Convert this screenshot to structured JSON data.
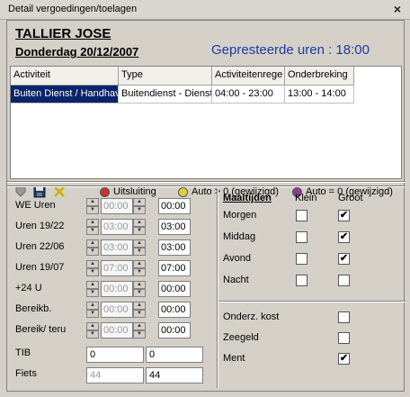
{
  "window": {
    "title": "Detail vergoedingen/toelagen",
    "close_glyph": "×"
  },
  "header": {
    "name": "TALLIER JOSE",
    "date": "Donderdag 20/12/2007",
    "hours_text": "Gepresteerde uren : 18:00"
  },
  "grid": {
    "columns": [
      "Activiteit",
      "Type",
      "Activiteitenrege",
      "Onderbreking"
    ],
    "rows": [
      [
        "Buiten Dienst / Handhav",
        "Buitendienst - Dienst",
        "04:00 - 23:00",
        "13:00 - 14:00"
      ]
    ]
  },
  "toolbar": {
    "icons": [
      "shield-icon",
      "save-icon",
      "cancel-icon"
    ],
    "legend": [
      {
        "label": "Uitsluiting",
        "color": "#c83232"
      },
      {
        "label": "Auto > 0 (gewijzigd)",
        "color": "#e0d23a"
      },
      {
        "label": "Auto = 0 (gewijzigd)",
        "color": "#8a3c96"
      }
    ]
  },
  "hours_rows": [
    {
      "label": "WE Uren",
      "from": "00:00",
      "to": "00:00",
      "from_dim": true,
      "to_dim": false
    },
    {
      "label": "Uren 19/22",
      "from": "03:00",
      "to": "03:00",
      "from_dim": true,
      "to_dim": false
    },
    {
      "label": "Uren 22/06",
      "from": "03:00",
      "to": "03:00",
      "from_dim": true,
      "to_dim": false
    },
    {
      "label": "Uren 19/07",
      "from": "07:00",
      "to": "07:00",
      "from_dim": true,
      "to_dim": false
    },
    {
      "label": "+24 U",
      "from": "00:00",
      "to": "00:00",
      "from_dim": true,
      "to_dim": false
    },
    {
      "label": "Bereikb.",
      "from": "00:00",
      "to": "00:00",
      "from_dim": true,
      "to_dim": false
    },
    {
      "label": "Bereik/ teru",
      "from": "00:00",
      "to": "00:00",
      "from_dim": true,
      "to_dim": false
    }
  ],
  "tib": {
    "label": "TIB",
    "left": "0",
    "right": "0"
  },
  "fiets": {
    "label": "Fiets",
    "left": "44",
    "right": "44"
  },
  "meals": {
    "title": "Maaltijden",
    "col_small": "Klein",
    "col_large": "Groot",
    "rows": [
      {
        "label": "Morgen",
        "klein": false,
        "groot": true
      },
      {
        "label": "Middag",
        "klein": false,
        "groot": true
      },
      {
        "label": "Avond",
        "klein": false,
        "groot": true
      },
      {
        "label": "Nacht",
        "klein": false,
        "groot": false
      }
    ]
  },
  "extras": [
    {
      "label": "Onderz. kost",
      "checked": false
    },
    {
      "label": "Zeegeld",
      "checked": false
    },
    {
      "label": "Ment",
      "checked": true
    }
  ],
  "check_glyph": "✔"
}
